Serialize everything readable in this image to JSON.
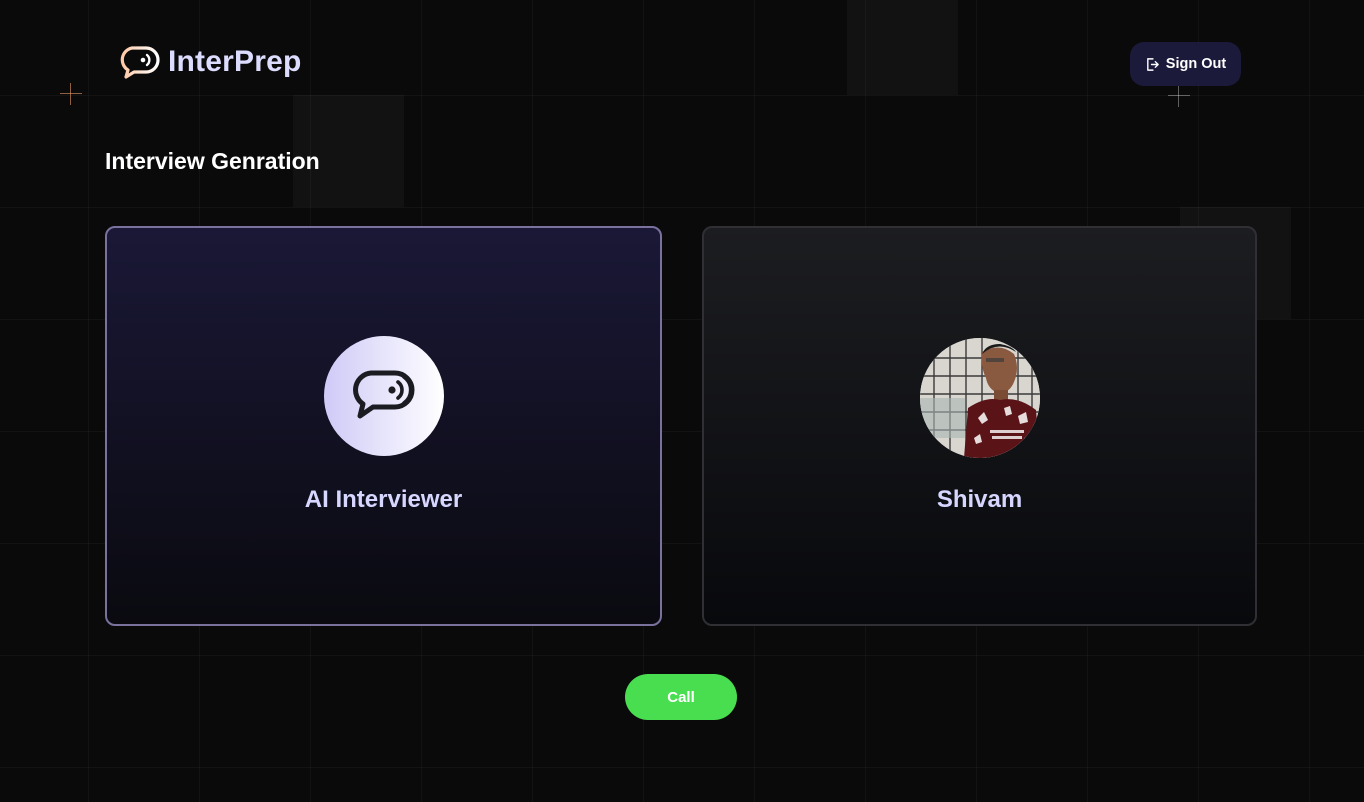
{
  "header": {
    "brand_name": "InterPrep",
    "logo_icon": "chat-bubble-sound-icon",
    "signout_label": "Sign Out",
    "signout_icon": "logout-icon"
  },
  "main": {
    "title": "Interview Genration",
    "cards": [
      {
        "name": "AI Interviewer",
        "avatar": "chat-bubble-sound-icon",
        "selected": true
      },
      {
        "name": "Shivam",
        "avatar": "user-photo"
      }
    ],
    "call_label": "Call"
  },
  "colors": {
    "background": "#0a0a0b",
    "brand_text": "#dcdcff",
    "accent_purple": "#1c1a3a",
    "call_green": "#49de50",
    "card_name": "#d6d6ff"
  }
}
